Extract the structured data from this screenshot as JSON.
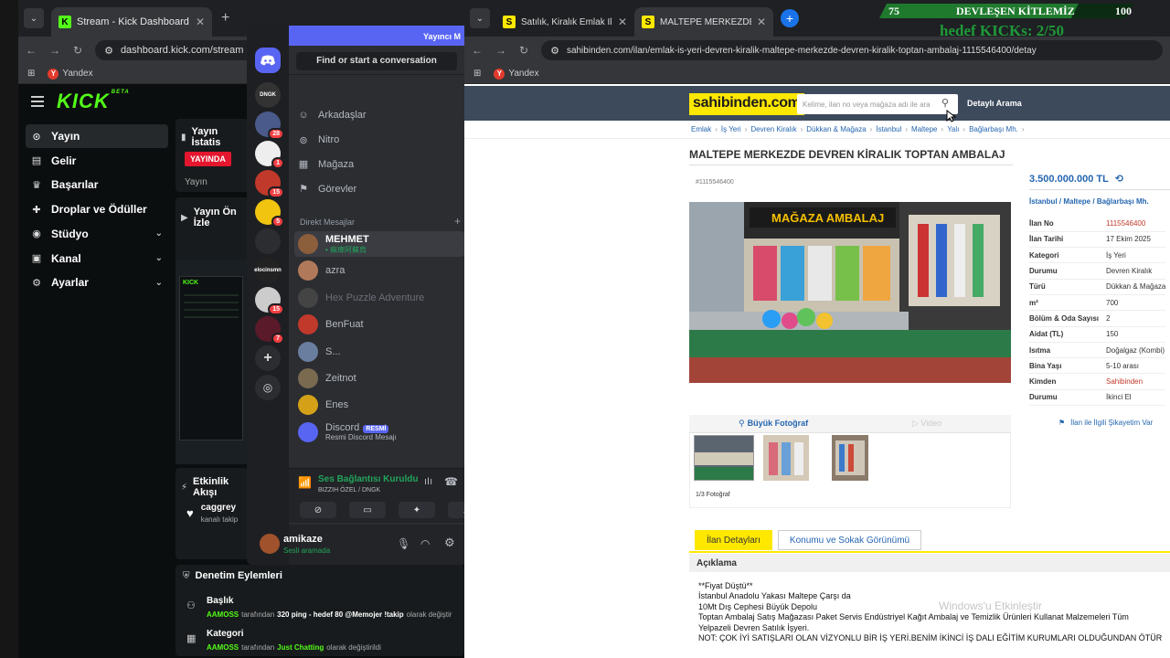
{
  "overlay": {
    "left": "75",
    "title": "DEVLEŞEN KİTLEMİZ",
    "right": "100",
    "goal": "hedef KICKs: 2/50"
  },
  "kick_browser": {
    "tab_title": "Stream - Kick Dashboard",
    "url": "dashboard.kick.com/stream",
    "bookmark": "Yandex"
  },
  "kick": {
    "logo": "KICK",
    "beta": "BETA",
    "nav": [
      {
        "label": "Yayın",
        "icon": "broadcast-icon"
      },
      {
        "label": "Gelir",
        "icon": "income-icon"
      },
      {
        "label": "Başarılar",
        "icon": "achievements-icon"
      },
      {
        "label": "Droplar ve Ödüller",
        "icon": "gift-icon"
      },
      {
        "label": "Stüdyo",
        "icon": "studio-icon"
      },
      {
        "label": "Kanal",
        "icon": "channel-icon"
      },
      {
        "label": "Ayarlar",
        "icon": "settings-icon"
      }
    ],
    "stats_title": "Yayın İstatis",
    "live_badge": "YAYINDA",
    "stats_row": "Yayın",
    "preview_title": "Yayın Ön İzle",
    "activity_title": "Etkinlik Akışı",
    "activity_user": "caggrey",
    "activity_text": "kanalı takip",
    "moderation_title": "Denetim Eylemleri",
    "moderation": [
      {
        "heading": "Başlık",
        "user": "AAMOSS",
        "mid": "tarafından",
        "value": "320 ping - hedef 80 @Memojer !takip",
        "tail": "olarak değiştir"
      },
      {
        "heading": "Kategori",
        "user": "AAMOSS",
        "mid": "tarafından",
        "value": "Just Chatting",
        "tail": "olarak değiştirildi"
      }
    ]
  },
  "discord": {
    "banner": "Yayıncı M",
    "find": "Find or start a conversation",
    "nav": [
      {
        "label": "Arkadaşlar",
        "icon": "friends-icon"
      },
      {
        "label": "Nitro",
        "icon": "nitro-icon"
      },
      {
        "label": "Mağaza",
        "icon": "shop-icon"
      },
      {
        "label": "Görevler",
        "icon": "quests-icon"
      }
    ],
    "dm_header": "Direkt Mesajlar",
    "dms": [
      {
        "name": "MEHMET",
        "sub": "• 痲痺阿蘇烏",
        "color": "#8b5e3c"
      },
      {
        "name": "azra",
        "sub": "",
        "color": "#b07a5a"
      },
      {
        "name": "Hex Puzzle Adventure",
        "sub": "",
        "color": "#444"
      },
      {
        "name": "BenFuat",
        "sub": "",
        "color": "#c0392b"
      },
      {
        "name": "S...",
        "sub": "",
        "color": "#6a7fa0"
      },
      {
        "name": "Zeitnot",
        "sub": "",
        "color": "#7a6a50"
      },
      {
        "name": "Enes",
        "sub": "",
        "color": "#d4a017"
      },
      {
        "name": "Discord",
        "sub": "Resmi Discord Mesajı",
        "color": "#5865f2"
      }
    ],
    "resmi": "RESMİ",
    "servers": [
      {
        "label": "DNGK",
        "color": "#333",
        "badge": ""
      },
      {
        "label": "",
        "color": "#4a5a8a",
        "badge": "28"
      },
      {
        "label": "",
        "color": "#eee",
        "badge": "1"
      },
      {
        "label": "",
        "color": "#c0392b",
        "badge": "15"
      },
      {
        "label": "",
        "color": "#f1c40f",
        "badge": "5"
      },
      {
        "label": "",
        "color": "#2b2d31",
        "badge": ""
      },
      {
        "label": "elocinsmn",
        "color": "#222",
        "badge": ""
      },
      {
        "label": "",
        "color": "#ccc",
        "badge": "15"
      },
      {
        "label": "",
        "color": "#5a1a2a",
        "badge": "7"
      }
    ],
    "voice_status": "Ses Bağlantısı Kuruldu",
    "voice_channel": "BIZZIH ÖZEL / DNGK",
    "username": "amikaze",
    "user_status": "Sesli aramada"
  },
  "sahibinden_browser": {
    "tabs": [
      {
        "title": "Satılık, Kiralık Emlak İlanları sah",
        "active": false
      },
      {
        "title": "MALTEPE MERKEZDE DEVREN K",
        "active": true
      }
    ],
    "url": "sahibinden.com/ilan/emlak-is-yeri-devren-kiralik-maltepe-merkezde-devren-kiralik-toptan-ambalaj-1115546400/detay",
    "bookmark": "Yandex"
  },
  "sahibinden": {
    "logo": "sahibinden.com",
    "search_placeholder": "Kelime, ilan no veya mağaza adı ile ara",
    "detailed_search": "Detaylı Arama",
    "breadcrumbs": [
      "Emlak",
      "İş Yeri",
      "Devren Kiralık",
      "Dükkan & Mağaza",
      "İstanbul",
      "Maltepe",
      "Yalı",
      "Bağlarbaşı Mh."
    ],
    "title": "MALTEPE MERKEZDE DEVREN KİRALIK TOPTAN AMBALAJ",
    "listing_ref": "#1115546400",
    "price": "3.500.000.000 TL",
    "location": [
      "İstanbul",
      "Maltepe",
      "Bağlarbaşı Mh."
    ],
    "details": [
      {
        "k": "İlan No",
        "v": "1115546400",
        "red": true
      },
      {
        "k": "İlan Tarihi",
        "v": "17 Ekim 2025",
        "red": false
      },
      {
        "k": "Kategori",
        "v": "İş Yeri",
        "red": false
      },
      {
        "k": "Durumu",
        "v": "Devren Kiralık",
        "red": false
      },
      {
        "k": "Türü",
        "v": "Dükkan & Mağaza",
        "red": false
      },
      {
        "k": "m²",
        "v": "700",
        "red": false
      },
      {
        "k": "Bölüm & Oda Sayısı",
        "v": "2",
        "red": false
      },
      {
        "k": "Aidat (TL)",
        "v": "150",
        "red": false
      },
      {
        "k": "Isıtma",
        "v": "Doğalgaz (Kombi)",
        "red": false
      },
      {
        "k": "Bina Yaşı",
        "v": "5-10 arası",
        "red": false
      },
      {
        "k": "Kimden",
        "v": "Sahibinden",
        "red": true
      },
      {
        "k": "Durumu",
        "v": "İkinci El",
        "red": false
      }
    ],
    "big_photo": "Büyük Fotoğraf",
    "video": "Video",
    "photo_count": "1/3 Fotoğraf",
    "complaint": "İlan ile İlgili Şikayetim Var",
    "tab_details": "İlan Detayları",
    "tab_location": "Konumu ve Sokak Görünümü",
    "description_title": "Açıklama",
    "description": [
      "**Fiyat Düştü**",
      "İstanbul Anadolu Yakası Maltepe Çarşı da",
      "10Mt Dış Cephesi Büyük Depolu",
      "Toptan Ambalaj Satış Mağazası Paket Servis Endüstriyel Kağıt Ambalaj ve Temizlik Ürünleri Kullanat Malzemeleri Tüm",
      "Yelpazeli Devren Satılık İşyeri.",
      "NOT: ÇOK İYİ SATIŞLARI OLAN VİZYONLU BİR İŞ YERİ.BENİM İKİNCİ İŞ DALI EĞİTİM KURUMLARI OLDUĞUNDAN ÖTÜR"
    ],
    "store_sign": "MAĞAZA AMBALAJ"
  },
  "watermark": "Windows'u Etkinleştir",
  "colors": {
    "kick_green": "#53fc18",
    "discord_blurple": "#5865f2",
    "sahibinden_yellow": "#ffe800",
    "link_blue": "#2566b0"
  }
}
